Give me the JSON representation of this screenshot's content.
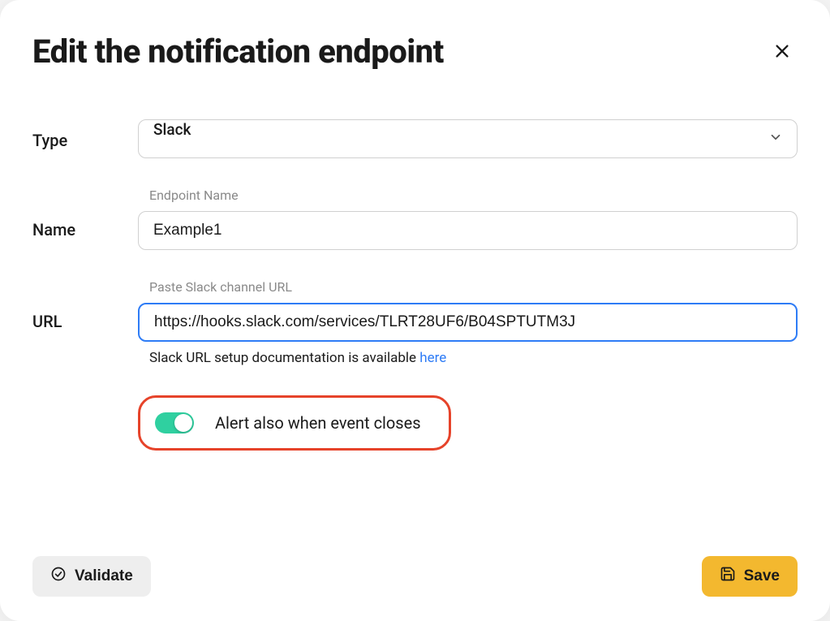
{
  "modal": {
    "title": "Edit the notification endpoint"
  },
  "form": {
    "type": {
      "label": "Type",
      "value": "Slack"
    },
    "name": {
      "label": "Name",
      "hint": "Endpoint Name",
      "value": "Example1"
    },
    "url": {
      "label": "URL",
      "hint": "Paste Slack channel URL",
      "value": "https://hooks.slack.com/services/TLRT28UF6/B04SPTUTM3J",
      "help_prefix": "Slack URL setup documentation is available ",
      "help_link_text": "here"
    },
    "alert_toggle": {
      "label": "Alert also when event closes",
      "enabled": true
    }
  },
  "footer": {
    "validate_label": "Validate",
    "save_label": "Save"
  }
}
